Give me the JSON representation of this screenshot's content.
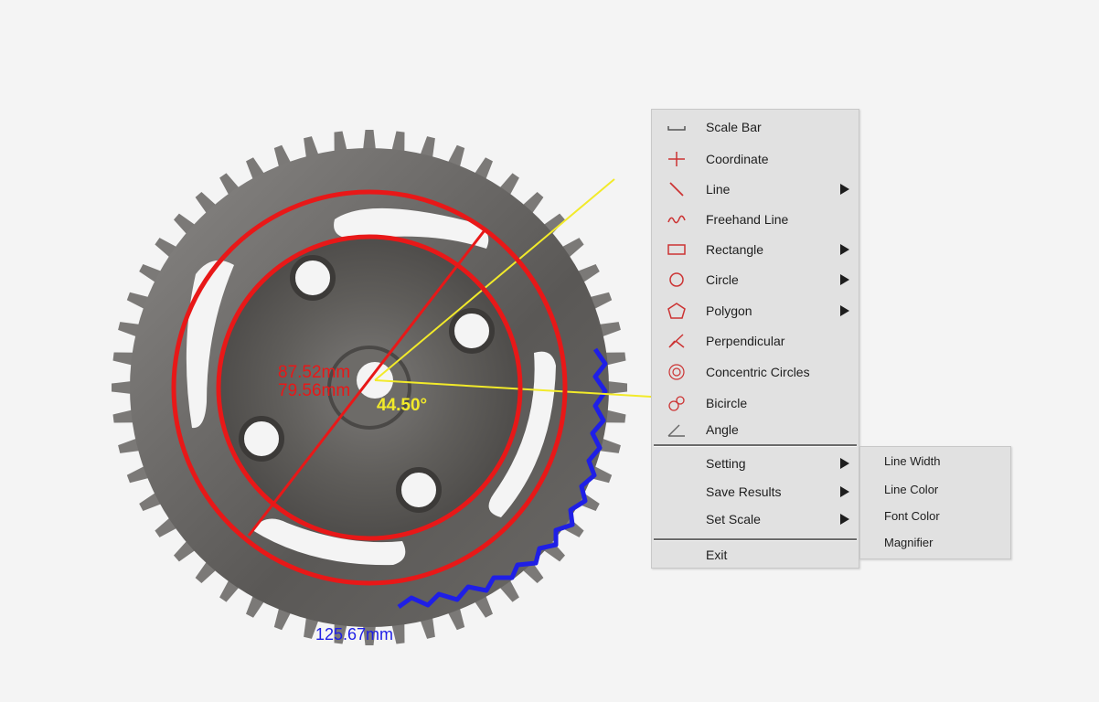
{
  "measurements": {
    "outer_diameter": "87.52mm",
    "inner_diameter": "79.56mm",
    "angle": "44.50°",
    "arc_length": "125.67mm"
  },
  "colors": {
    "measure_red": "#e81818",
    "measure_blue": "#1f1fe6",
    "measure_yellow": "#f2ea2a",
    "menu_bg": "#e1e1e1",
    "background": "#f4f4f4"
  },
  "context_menu": {
    "items": [
      {
        "label": "Scale Bar",
        "icon": "scale-bar-icon",
        "submenu": false
      },
      {
        "label": "Coordinate",
        "icon": "coordinate-icon",
        "submenu": false
      },
      {
        "label": "Line",
        "icon": "line-icon",
        "submenu": true
      },
      {
        "label": "Freehand Line",
        "icon": "freehand-line-icon",
        "submenu": false
      },
      {
        "label": "Rectangle",
        "icon": "rectangle-icon",
        "submenu": true
      },
      {
        "label": "Circle",
        "icon": "circle-icon",
        "submenu": true
      },
      {
        "label": "Polygon",
        "icon": "polygon-icon",
        "submenu": true
      },
      {
        "label": "Perpendicular",
        "icon": "perpendicular-icon",
        "submenu": false
      },
      {
        "label": "Concentric Circles",
        "icon": "concentric-circles-icon",
        "submenu": false
      },
      {
        "label": "Bicircle",
        "icon": "bicircle-icon",
        "submenu": false
      },
      {
        "label": "Angle",
        "icon": "angle-icon",
        "submenu": false
      }
    ],
    "settings_items": [
      {
        "label": "Setting",
        "submenu": true
      },
      {
        "label": "Save Results",
        "submenu": true
      },
      {
        "label": "Set Scale",
        "submenu": true
      }
    ],
    "exit_label": "Exit"
  },
  "setting_submenu": {
    "items": [
      "Line Width",
      "Line Color",
      "Font Color",
      "Magnifier"
    ]
  }
}
